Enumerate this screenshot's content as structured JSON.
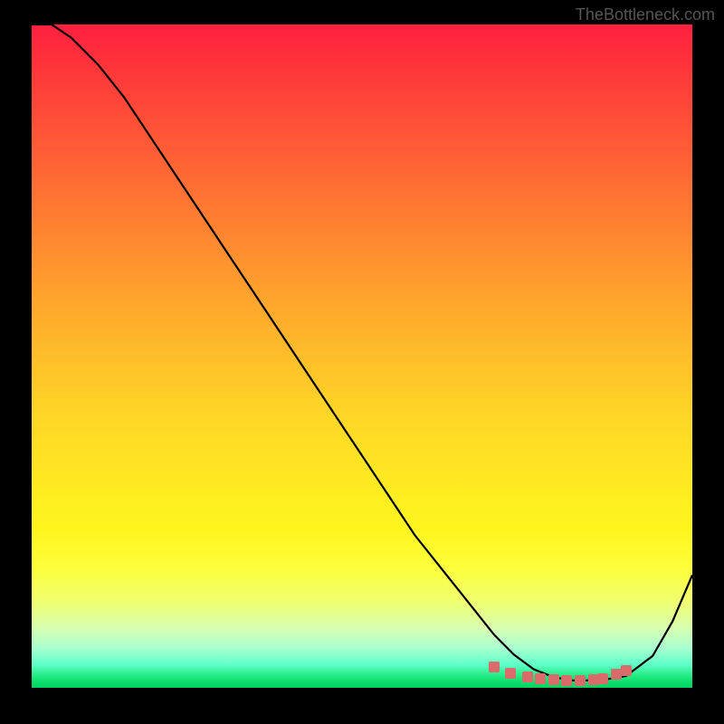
{
  "watermark": "TheBottleneck.com",
  "chart_data": {
    "type": "line",
    "title": "",
    "xlabel": "",
    "ylabel": "",
    "xlim": [
      0,
      100
    ],
    "ylim": [
      0,
      100
    ],
    "series": [
      {
        "name": "curve",
        "x": [
          0,
          3,
          6,
          10,
          14,
          18,
          22,
          26,
          30,
          34,
          38,
          42,
          46,
          50,
          54,
          58,
          62,
          66,
          70,
          73,
          76,
          79,
          82,
          86,
          90,
          94,
          97,
          100
        ],
        "y": [
          100,
          100,
          98,
          94,
          89,
          83,
          77,
          71,
          65,
          59,
          53,
          47,
          41,
          35,
          29,
          23,
          18,
          13,
          8,
          5,
          2.8,
          1.6,
          1.1,
          1.1,
          1.8,
          4.8,
          10,
          17
        ]
      }
    ],
    "markers": {
      "name": "highlight",
      "points": [
        {
          "x": 70.0,
          "y": 3.2
        },
        {
          "x": 72.5,
          "y": 2.2
        },
        {
          "x": 75.0,
          "y": 1.7
        },
        {
          "x": 77.0,
          "y": 1.4
        },
        {
          "x": 79.0,
          "y": 1.2
        },
        {
          "x": 81.0,
          "y": 1.1
        },
        {
          "x": 83.0,
          "y": 1.1
        },
        {
          "x": 85.0,
          "y": 1.2
        },
        {
          "x": 86.5,
          "y": 1.4
        },
        {
          "x": 88.5,
          "y": 2.0
        },
        {
          "x": 90.0,
          "y": 2.6
        }
      ]
    },
    "gradient_stops": [
      {
        "pos": 0,
        "color": "#ff203f"
      },
      {
        "pos": 0.5,
        "color": "#ffc827"
      },
      {
        "pos": 0.85,
        "color": "#fdff40"
      },
      {
        "pos": 1.0,
        "color": "#00d060"
      }
    ]
  }
}
